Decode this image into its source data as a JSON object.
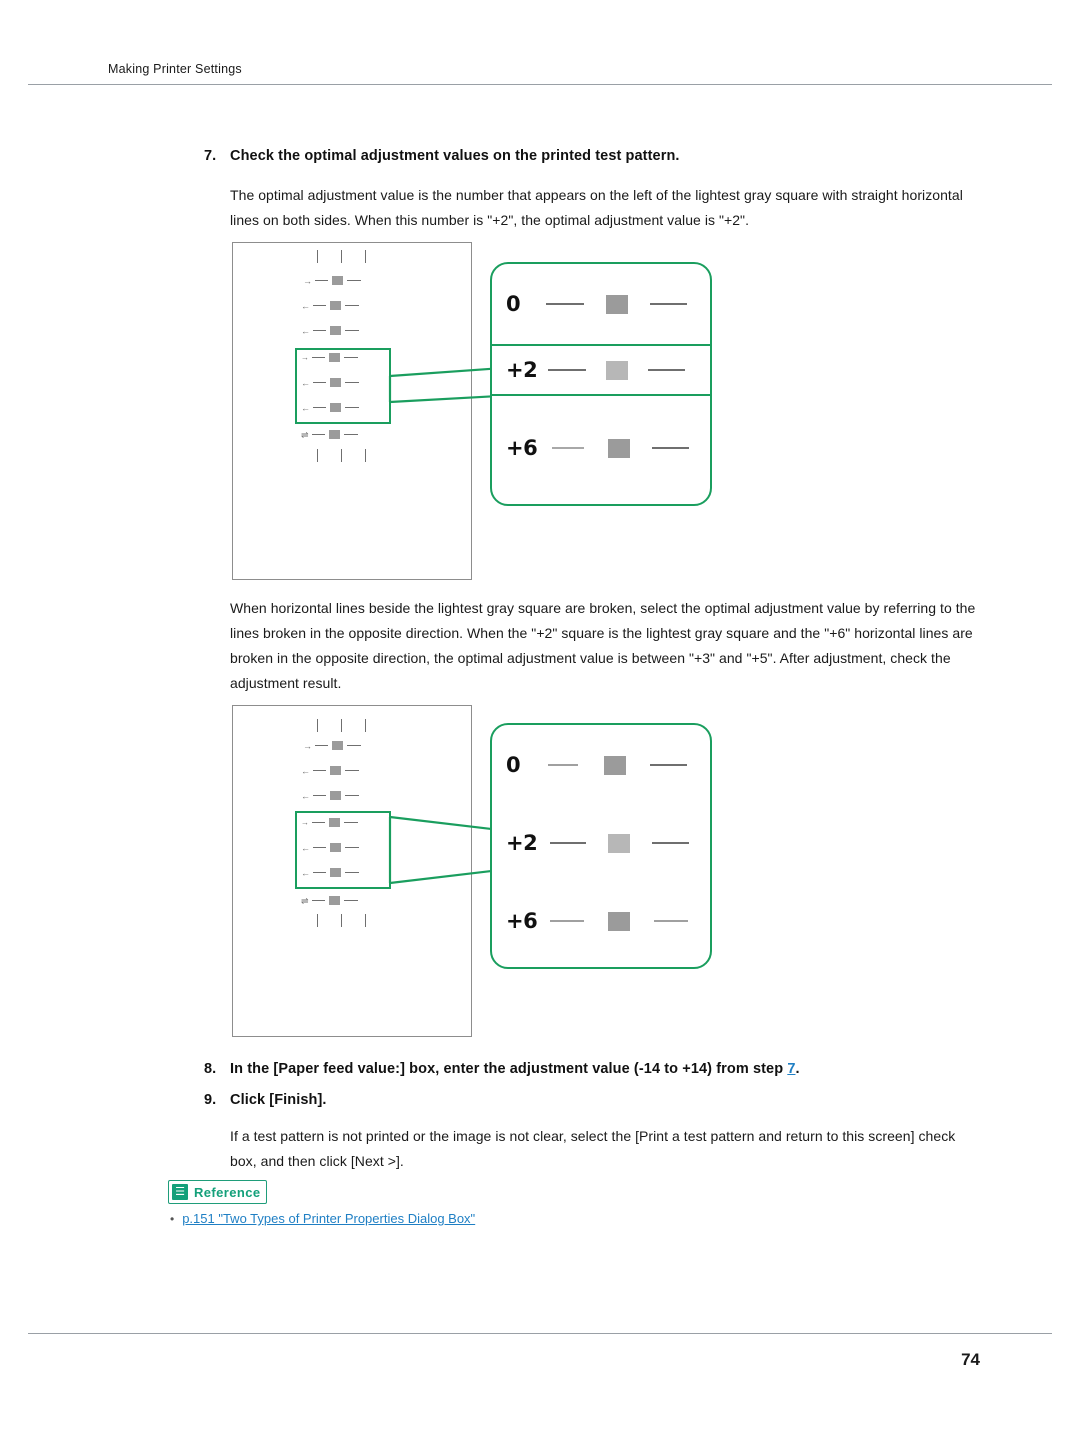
{
  "header": {
    "title": "Making Printer Settings"
  },
  "footer": {
    "page_number": "74"
  },
  "steps": [
    {
      "number": "7.",
      "title": "Check the optimal adjustment values on the printed test pattern.",
      "body": "The optimal adjustment value is the number that appears on the left of the lightest gray square with straight horizontal lines on both sides. When this number is \"+2\", the optimal adjustment value is \"+2\"."
    },
    {
      "number": "8.",
      "title_before_link": "In the [Paper feed value:] box, enter the adjustment value (-14 to +14) from step ",
      "link": "7",
      "title_after_link": "."
    },
    {
      "number": "9.",
      "title": "Click [Finish].",
      "body": "If a test pattern is not printed or the image is not clear, select the [Print a test pattern and return to this screen] check box, and then click [Next >]."
    }
  ],
  "middle_paragraph": "When horizontal lines beside the lightest gray square are broken, select the optimal adjustment value by referring to the lines broken in the opposite direction. When the \"+2\" square is the lightest gray square and the \"+6\" horizontal lines are broken in the opposite direction, the optimal adjustment value is between \"+3\" and \"+5\". After adjustment, check the adjustment result.",
  "reference": {
    "badge_label": "Reference",
    "badge_icon": "book-icon",
    "items": [
      {
        "bullet": "•",
        "text": "p.151 \"Two Types of Printer Properties Dialog Box\""
      }
    ]
  },
  "figures": [
    {
      "name": "test-pattern-figure-straight-lines",
      "callout_values": [
        "0",
        "+2",
        "+6"
      ],
      "selected_value": "+2"
    },
    {
      "name": "test-pattern-figure-broken-lines",
      "callout_values": [
        "0",
        "+2",
        "+6"
      ],
      "selected_value": "+2"
    }
  ],
  "colors": {
    "accent_green": "#1a9e5e",
    "link_blue": "#1f7fc4",
    "rule_gray": "#9aa0a6",
    "gray_square": "#9b9b9b"
  }
}
